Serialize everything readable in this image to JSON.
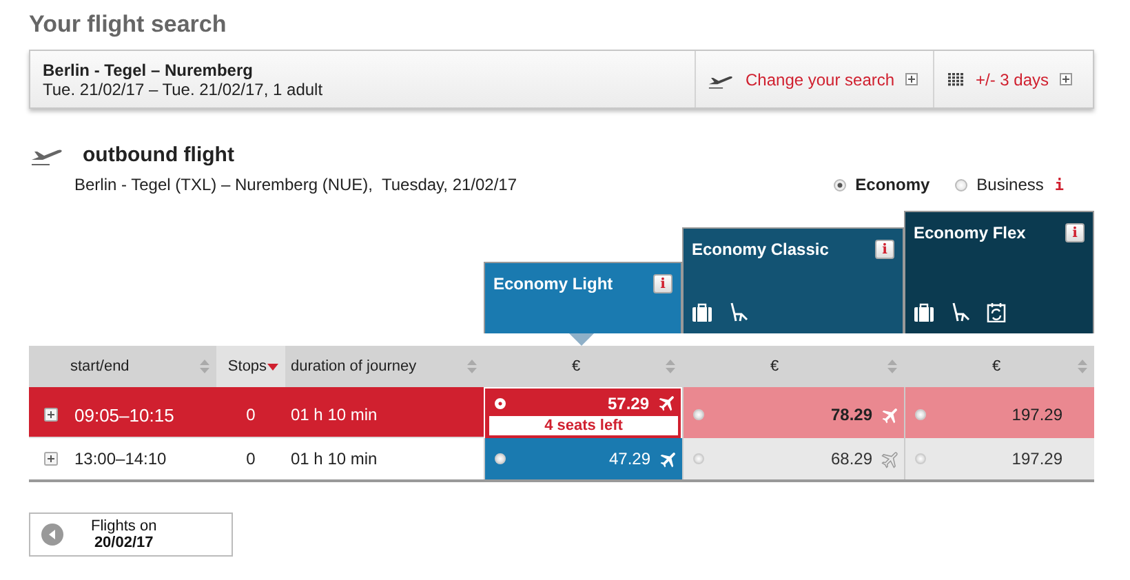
{
  "page_title": "Your flight search",
  "search_summary": {
    "route": "Berlin - Tegel – Nuremberg",
    "dates": "Tue. 21/02/17 – Tue. 21/02/17, 1 adult",
    "actions": [
      {
        "label": "Change your search",
        "kind": "plane"
      },
      {
        "label": "+/- 3 days",
        "kind": "calendar"
      }
    ]
  },
  "outbound": {
    "title": "outbound flight",
    "details": "Berlin - Tegel (TXL) – Nuremberg (NUE),  Tuesday, 21/02/17"
  },
  "cabin_classes": [
    {
      "label": "Economy",
      "selected": true
    },
    {
      "label": "Business",
      "selected": false
    }
  ],
  "cabin_info": "i",
  "fares": [
    {
      "name": "Economy Light",
      "info": "i",
      "selected": true,
      "baggage": false,
      "seat": false,
      "rebook": false
    },
    {
      "name": "Economy Classic",
      "info": "i",
      "selected": false,
      "baggage": true,
      "seat": true,
      "rebook": false
    },
    {
      "name": "Economy Flex",
      "info": "i",
      "selected": false,
      "baggage": true,
      "seat": true,
      "rebook": true
    }
  ],
  "table": {
    "columns": [
      {
        "label": "start/end",
        "sorted": false
      },
      {
        "label": "Stops",
        "sorted": true
      },
      {
        "label": "duration of journey",
        "sorted": false
      },
      {
        "label": "€",
        "sorted": false
      },
      {
        "label": "€",
        "sorted": false
      },
      {
        "label": "€",
        "sorted": false
      }
    ],
    "rows": [
      {
        "selected": true,
        "time": "09:05–10:15",
        "stops": "0",
        "duration": "01 h 10 min",
        "prices": [
          {
            "amount": "57.29",
            "selected": true,
            "flight_icon": true,
            "muted": false,
            "note": "4 seats left"
          },
          {
            "amount": "78.29",
            "selected": false,
            "flight_icon": true,
            "muted": false
          },
          {
            "amount": "197.29",
            "selected": false,
            "flight_icon": false
          }
        ]
      },
      {
        "selected": false,
        "time": "13:00–14:10",
        "stops": "0",
        "duration": "01 h 10 min",
        "prices": [
          {
            "amount": "47.29",
            "selected": false,
            "flight_icon": true,
            "muted": false
          },
          {
            "amount": "68.29",
            "selected": false,
            "flight_icon": true,
            "muted": true
          },
          {
            "amount": "197.29",
            "selected": false,
            "flight_icon": false
          }
        ]
      }
    ]
  },
  "previous_day": {
    "label": "Flights on",
    "date": "20/02/17"
  }
}
